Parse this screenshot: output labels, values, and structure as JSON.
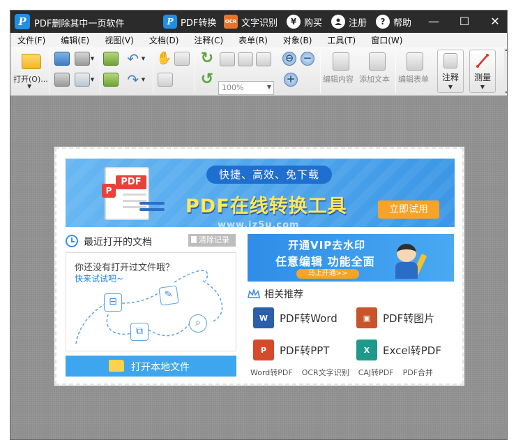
{
  "title_bar": {
    "app_title": "PDF删除其中一页软件",
    "pdf_convert": "PDF转换",
    "ocr_icon": "OCR",
    "ocr": "文字识别",
    "buy_icon": "¥",
    "buy": "购买",
    "register": "注册",
    "help_icon": "?",
    "help": "帮助",
    "minimize": "—",
    "maximize": "☐",
    "close": "✕"
  },
  "menu": [
    "文件(F)",
    "编辑(E)",
    "视图(V)",
    "文档(D)",
    "注释(C)",
    "表单(R)",
    "对象(B)",
    "工具(T)",
    "窗口(W)"
  ],
  "toolbar": {
    "open_label": "打开(O)...",
    "zoom_value": "100%",
    "edit_content": "编辑内容",
    "add_text": "添加文本",
    "edit_form": "编辑表单",
    "annotate": "注释",
    "measure": "测量"
  },
  "banner": {
    "tagline": "快捷、高效、免下载",
    "title": "PDF在线转换工具",
    "try_button": "立即试用",
    "pdf_badge": "PDF",
    "p_badge": "P",
    "watermark": "www.jz5u.com"
  },
  "recent": {
    "title": "最近打开的文档",
    "clear_button": "清除记录",
    "empty_text": "你还没有打开过文件哦？",
    "empty_link": "快来试试吧~",
    "open_local": "打开本地文件"
  },
  "vip": {
    "line1": "开通VIP去水印",
    "line2": "任意编辑 功能全面",
    "button": "马上开通>>"
  },
  "recommend": {
    "title": "相关推荐",
    "items": [
      {
        "label": "PDF转Word",
        "icon": "word-doc-icon",
        "color": "#2b5fa8",
        "glyph": "W"
      },
      {
        "label": "PDF转图片",
        "icon": "image-icon",
        "color": "#c9532b",
        "glyph": "▣"
      },
      {
        "label": "PDF转PPT",
        "icon": "ppt-icon",
        "color": "#d54a2a",
        "glyph": "P"
      },
      {
        "label": "Excel转PDF",
        "icon": "excel-icon",
        "color": "#1d9a8a",
        "glyph": "X"
      }
    ],
    "links": [
      "Word转PDF",
      "OCR文字识别",
      "CAJ转PDF",
      "PDF合并"
    ]
  },
  "colors": {
    "accent_blue": "#3ea6ef",
    "orange": "#f7a326",
    "title_bar": "#2b2b2b"
  }
}
